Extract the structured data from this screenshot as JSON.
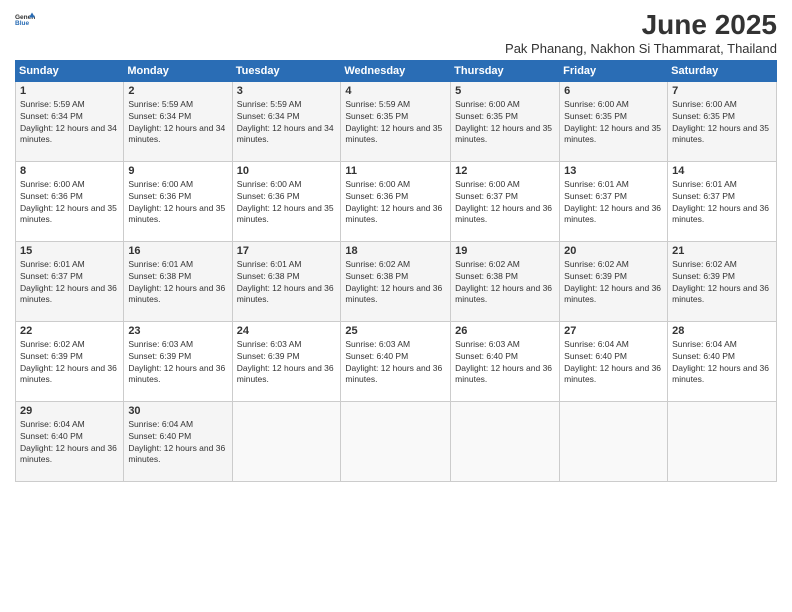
{
  "header": {
    "logo_general": "General",
    "logo_blue": "Blue",
    "month_title": "June 2025",
    "location": "Pak Phanang, Nakhon Si Thammarat, Thailand"
  },
  "weekdays": [
    "Sunday",
    "Monday",
    "Tuesday",
    "Wednesday",
    "Thursday",
    "Friday",
    "Saturday"
  ],
  "weeks": [
    [
      {
        "day": "1",
        "sunrise": "5:59 AM",
        "sunset": "6:34 PM",
        "daylight": "12 hours and 34 minutes."
      },
      {
        "day": "2",
        "sunrise": "5:59 AM",
        "sunset": "6:34 PM",
        "daylight": "12 hours and 34 minutes."
      },
      {
        "day": "3",
        "sunrise": "5:59 AM",
        "sunset": "6:34 PM",
        "daylight": "12 hours and 34 minutes."
      },
      {
        "day": "4",
        "sunrise": "5:59 AM",
        "sunset": "6:35 PM",
        "daylight": "12 hours and 35 minutes."
      },
      {
        "day": "5",
        "sunrise": "6:00 AM",
        "sunset": "6:35 PM",
        "daylight": "12 hours and 35 minutes."
      },
      {
        "day": "6",
        "sunrise": "6:00 AM",
        "sunset": "6:35 PM",
        "daylight": "12 hours and 35 minutes."
      },
      {
        "day": "7",
        "sunrise": "6:00 AM",
        "sunset": "6:35 PM",
        "daylight": "12 hours and 35 minutes."
      }
    ],
    [
      {
        "day": "8",
        "sunrise": "6:00 AM",
        "sunset": "6:36 PM",
        "daylight": "12 hours and 35 minutes."
      },
      {
        "day": "9",
        "sunrise": "6:00 AM",
        "sunset": "6:36 PM",
        "daylight": "12 hours and 35 minutes."
      },
      {
        "day": "10",
        "sunrise": "6:00 AM",
        "sunset": "6:36 PM",
        "daylight": "12 hours and 35 minutes."
      },
      {
        "day": "11",
        "sunrise": "6:00 AM",
        "sunset": "6:36 PM",
        "daylight": "12 hours and 36 minutes."
      },
      {
        "day": "12",
        "sunrise": "6:00 AM",
        "sunset": "6:37 PM",
        "daylight": "12 hours and 36 minutes."
      },
      {
        "day": "13",
        "sunrise": "6:01 AM",
        "sunset": "6:37 PM",
        "daylight": "12 hours and 36 minutes."
      },
      {
        "day": "14",
        "sunrise": "6:01 AM",
        "sunset": "6:37 PM",
        "daylight": "12 hours and 36 minutes."
      }
    ],
    [
      {
        "day": "15",
        "sunrise": "6:01 AM",
        "sunset": "6:37 PM",
        "daylight": "12 hours and 36 minutes."
      },
      {
        "day": "16",
        "sunrise": "6:01 AM",
        "sunset": "6:38 PM",
        "daylight": "12 hours and 36 minutes."
      },
      {
        "day": "17",
        "sunrise": "6:01 AM",
        "sunset": "6:38 PM",
        "daylight": "12 hours and 36 minutes."
      },
      {
        "day": "18",
        "sunrise": "6:02 AM",
        "sunset": "6:38 PM",
        "daylight": "12 hours and 36 minutes."
      },
      {
        "day": "19",
        "sunrise": "6:02 AM",
        "sunset": "6:38 PM",
        "daylight": "12 hours and 36 minutes."
      },
      {
        "day": "20",
        "sunrise": "6:02 AM",
        "sunset": "6:39 PM",
        "daylight": "12 hours and 36 minutes."
      },
      {
        "day": "21",
        "sunrise": "6:02 AM",
        "sunset": "6:39 PM",
        "daylight": "12 hours and 36 minutes."
      }
    ],
    [
      {
        "day": "22",
        "sunrise": "6:02 AM",
        "sunset": "6:39 PM",
        "daylight": "12 hours and 36 minutes."
      },
      {
        "day": "23",
        "sunrise": "6:03 AM",
        "sunset": "6:39 PM",
        "daylight": "12 hours and 36 minutes."
      },
      {
        "day": "24",
        "sunrise": "6:03 AM",
        "sunset": "6:39 PM",
        "daylight": "12 hours and 36 minutes."
      },
      {
        "day": "25",
        "sunrise": "6:03 AM",
        "sunset": "6:40 PM",
        "daylight": "12 hours and 36 minutes."
      },
      {
        "day": "26",
        "sunrise": "6:03 AM",
        "sunset": "6:40 PM",
        "daylight": "12 hours and 36 minutes."
      },
      {
        "day": "27",
        "sunrise": "6:04 AM",
        "sunset": "6:40 PM",
        "daylight": "12 hours and 36 minutes."
      },
      {
        "day": "28",
        "sunrise": "6:04 AM",
        "sunset": "6:40 PM",
        "daylight": "12 hours and 36 minutes."
      }
    ],
    [
      {
        "day": "29",
        "sunrise": "6:04 AM",
        "sunset": "6:40 PM",
        "daylight": "12 hours and 36 minutes."
      },
      {
        "day": "30",
        "sunrise": "6:04 AM",
        "sunset": "6:40 PM",
        "daylight": "12 hours and 36 minutes."
      },
      null,
      null,
      null,
      null,
      null
    ]
  ],
  "labels": {
    "sunrise": "Sunrise:",
    "sunset": "Sunset:",
    "daylight": "Daylight:"
  }
}
